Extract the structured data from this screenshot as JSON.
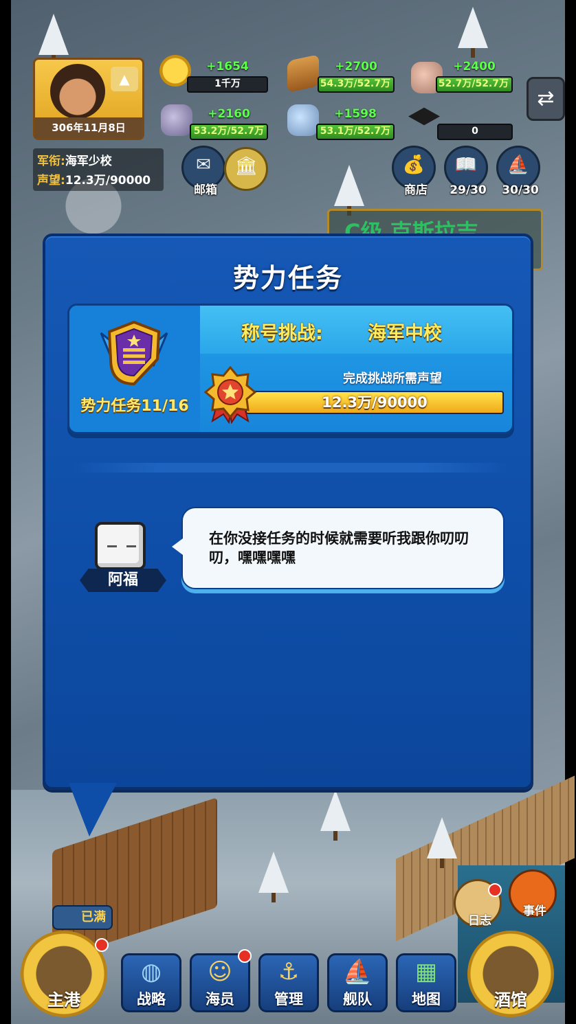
{
  "player": {
    "date": "306年11月8日",
    "rank_key": "军衔:",
    "rank_value": "海军少校",
    "prestige_key": "声望:",
    "prestige_value": "12.3万/90000"
  },
  "resources": [
    {
      "name": "gold",
      "gain": "+1654",
      "text": "1千万",
      "fill": 0
    },
    {
      "name": "wood",
      "gain": "+2700",
      "text": "54.3万/52.7万",
      "fill": 1.0
    },
    {
      "name": "stone",
      "gain": "+2400",
      "text": "52.7万/52.7万",
      "fill": 1.0
    },
    {
      "name": "iron",
      "gain": "+2160",
      "text": "53.2万/52.7万",
      "fill": 1.0
    },
    {
      "name": "crystal",
      "gain": "+1598",
      "text": "53.1万/52.7万",
      "fill": 1.0
    },
    {
      "name": "scholar",
      "gain": "",
      "text": "0",
      "fill": 0
    }
  ],
  "hud_buttons": {
    "mail": "邮箱",
    "shop": "商店",
    "book": "29/30",
    "sail": "30/30"
  },
  "behind_label": "C级 克斯拉吉",
  "dialog": {
    "title": "势力任务",
    "challenge_prefix": "称号挑战:",
    "challenge_target": "海军中校",
    "mission_progress": "势力任务11/16",
    "requirement_label": "完成挑战所需声望",
    "prestige_progress_text": "12.3万/90000",
    "prestige_progress_fraction": 1.0,
    "npc_name": "阿福",
    "npc_speech": "在你没接任务的时候就需要听我跟你叨叨叨，嘿嘿嘿嘿"
  },
  "bottom_nav": {
    "home": "主港",
    "full_tag": "已满",
    "strategy": "战略",
    "crew": "海员",
    "manage": "管理",
    "fleet": "舰队",
    "map": "地图",
    "tavern": "酒馆",
    "log": "日志",
    "event": "事件"
  },
  "colors": {
    "dialog_bg": "#1658b5",
    "title_gold": "#ffec5e",
    "gain_green": "#5cff4a",
    "bar_fill_yellow": "#f0a91a"
  }
}
